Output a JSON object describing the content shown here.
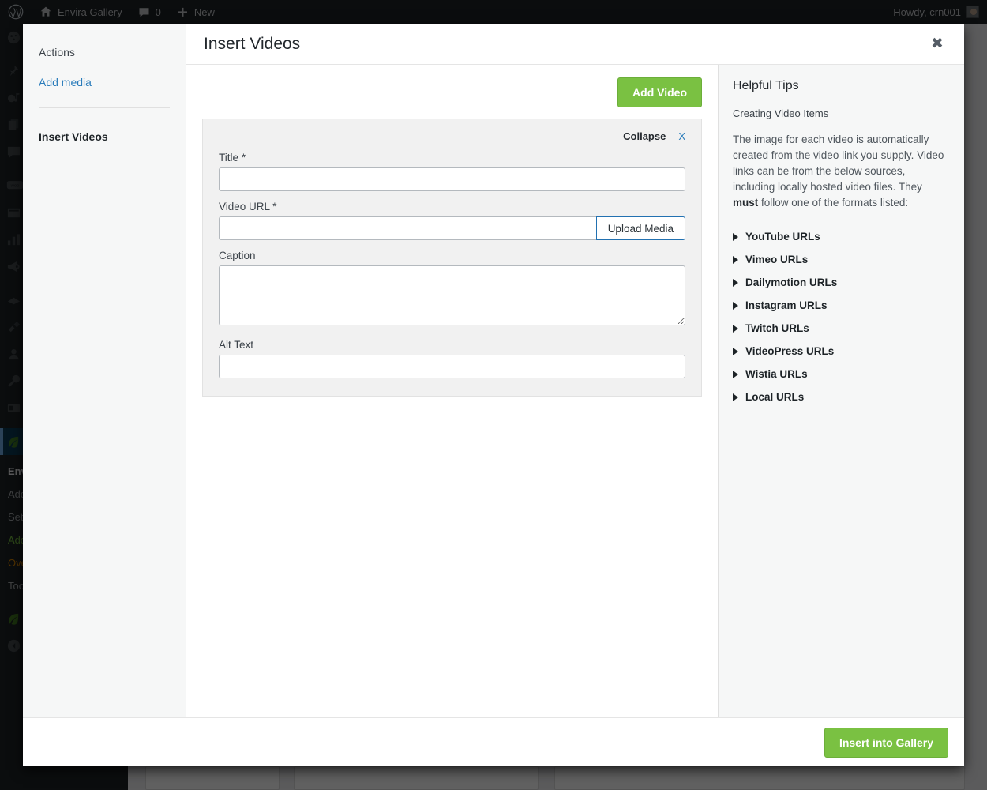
{
  "adminbar": {
    "logo_icon": "wordpress-logo-icon",
    "home_icon": "home-icon",
    "site_name": "Envira Gallery",
    "comments_icon": "comment-bubble-icon",
    "comments_count": "0",
    "new_icon": "plus-icon",
    "new_label": "New",
    "howdy": "Howdy, crn001",
    "avatar_icon": "user-avatar"
  },
  "adminmenu": {
    "icons": [
      "dashboard-icon",
      "posts-pin-icon",
      "media-icon",
      "pages-icon",
      "comments-icon",
      "woocommerce-icon",
      "products-icon",
      "analytics-icon",
      "marketing-icon",
      "appearance-icon",
      "plugins-icon",
      "users-icon",
      "tools-icon",
      "settings-icon",
      "envira-leaf-icon"
    ],
    "submenu": [
      "Envira Gallery",
      "Add New",
      "Settings",
      "Addons",
      "Overview",
      "Tools"
    ],
    "bottom_icon": "envira-leaf-icon",
    "collapse_icon": "collapse-arrow-icon"
  },
  "modal": {
    "title": "Insert Videos",
    "close_icon": "close-icon",
    "close_label": "✖"
  },
  "sidebar": {
    "heading": "Actions",
    "add_media_label": "Add media",
    "current_label": "Insert Videos"
  },
  "toolbar": {
    "add_video_label": "Add Video"
  },
  "video_card": {
    "collapse_label": "Collapse",
    "remove_label": "X",
    "fields": [
      {
        "name": "title",
        "label": "Title *",
        "value": "",
        "placeholder": ""
      },
      {
        "name": "url",
        "label": "Video URL *",
        "value": "",
        "placeholder": ""
      },
      {
        "name": "caption",
        "label": "Caption",
        "value": "",
        "placeholder": ""
      },
      {
        "name": "alt",
        "label": "Alt Text",
        "value": "",
        "placeholder": ""
      }
    ],
    "upload_media_label": "Upload Media"
  },
  "tips": {
    "title": "Helpful Tips",
    "subtitle": "Creating Video Items",
    "paragraph_part1": "The image for each video is automatically created from the video link you supply. Video links can be from the below sources, including locally hosted video files. They ",
    "paragraph_bold": "must",
    "paragraph_part2": " follow one of the formats listed:",
    "accordion": [
      {
        "label": "YouTube URLs",
        "icon": "caret-right-icon"
      },
      {
        "label": "Vimeo URLs",
        "icon": "caret-right-icon"
      },
      {
        "label": "Dailymotion URLs",
        "icon": "caret-right-icon"
      },
      {
        "label": "Instagram URLs",
        "icon": "caret-right-icon"
      },
      {
        "label": "Twitch URLs",
        "icon": "caret-right-icon"
      },
      {
        "label": "VideoPress URLs",
        "icon": "caret-right-icon"
      },
      {
        "label": "Wistia URLs",
        "icon": "caret-right-icon"
      },
      {
        "label": "Local URLs",
        "icon": "caret-right-icon"
      }
    ]
  },
  "footer": {
    "insert_label": "Insert into Gallery"
  },
  "colors": {
    "green": "#7ac142",
    "link_blue": "#2a7cbb",
    "admin_dark": "#1d2327",
    "card_gray": "#f1f1f1",
    "panel_gray": "#f6f7f7"
  }
}
